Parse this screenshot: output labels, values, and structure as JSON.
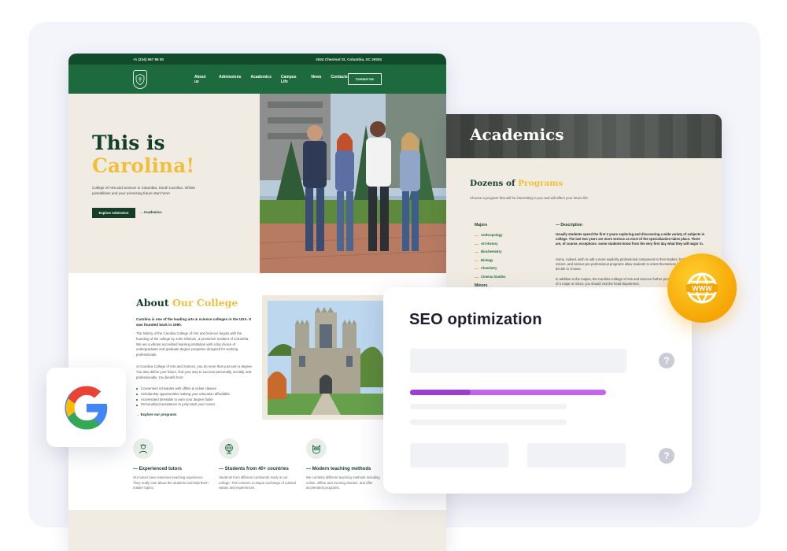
{
  "site": {
    "phone": "+1 (234) 567 89 00",
    "address": "2624 Chestnut St, Columbia, SC 29204",
    "menu": [
      "About us",
      "Admissions",
      "Academics",
      "Campus Life",
      "News",
      "Contacts"
    ],
    "contact_button": "Contact Us",
    "hero": {
      "title_line1": "This is",
      "title_line2": "Carolina!",
      "description": "College of Arts and Science in Columbia, South Carolina. Infinite possibilities and your promising future start here!",
      "primary_button": "Explore Admission",
      "secondary_link": "Academics"
    },
    "about": {
      "title_plain": "About",
      "title_accent": "Our College",
      "lead": "Carolina is one of the leading arts & science colleges in the USA. It was founded back in 1990.",
      "paragraph1": "The history of the Carolina College of Arts and Science begins with the founding of the college by John Gilstone, a prominent resident of Columbia. We are a vibrant accredited learning institution with a big choice of undergraduate and graduate degree programs designed for working professionals.",
      "paragraph2": "At Carolina College of Arts and Science, you do more than just earn a degree. You also define your future, find your way to success personally, socially, and professionally. You benefit from:",
      "benefits": [
        "Convenient schedules with offline & online classes",
        "Scholarship opportunities making your education affordable",
        "Accelerated timetable to earn your degree faster",
        "Personalized assistance to jump-start your career"
      ],
      "link": "Explore our programs"
    },
    "features": [
      {
        "icon": "tutor-icon",
        "title": "— Experienced tutors",
        "text": "Our tutors have extensive teaching experience. They really care about the students and help them master topics."
      },
      {
        "icon": "globe-icon",
        "title": "— Students from 40+ countries",
        "text": "Students from different continents study in our college. This ensures a unique exchange of cultural values and experiences."
      },
      {
        "icon": "owl-icon",
        "title": "— Modern teaching methods",
        "text": "We combine different teaching methods including online, offline and evening classes, and offer accelerated programs."
      }
    ]
  },
  "academics": {
    "header": "Academics",
    "title_plain": "Dozens of",
    "title_accent": "Programs",
    "subtitle": "Choose a program that will be interesting to you and will affect your future life.",
    "majors_label": "Majors",
    "majors": [
      "Anthropology",
      "Art History",
      "Biochemistry",
      "Biology",
      "Chemistry",
      "Cinema Studies"
    ],
    "minors_label": "Minors",
    "description_label": "— Description",
    "desc1": "Usually students spend the first 2 years exploring and discovering a wide variety of subjects in college. The last two years are more serious as most of the specialization takes place. There are, of course, exceptions: some students know from the very first day what they will major in.",
    "desc2": "Some, indeed, wish to add a more explicitly professional component to their studies, both majors and minors, and various pre-professional programs allow students to orient themselves for any role they decide to choose.",
    "desc3": "In addition to the majors, the Carolina College of Arts and Science further provides request declaration of a major or minor, you should visit the head department."
  },
  "seo": {
    "title": "SEO optimization",
    "progress": 0.31,
    "help_glyph": "?"
  },
  "colors": {
    "brand_green": "#1e6a3f",
    "dark_green": "#143e27",
    "accent_gold": "#f0bf3c",
    "seo_purple": "#c565ee",
    "badge_orange": "#f5a300"
  }
}
